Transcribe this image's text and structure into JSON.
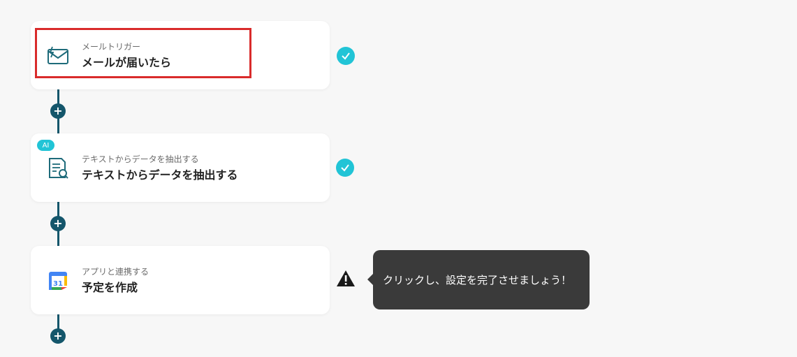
{
  "flow": {
    "steps": [
      {
        "subtitle": "メールトリガー",
        "title": "メールが届いたら",
        "icon": "mail-trigger-icon",
        "status": "check-icon"
      },
      {
        "subtitle": "テキストからデータを抽出する",
        "title": "テキストからデータを抽出する",
        "icon": "document-search-icon",
        "badge": "AI",
        "status": "check-icon"
      },
      {
        "subtitle": "アプリと連携する",
        "title": "予定を作成",
        "icon": "google-calendar-icon",
        "status": "warning-icon"
      }
    ],
    "calendar_day": "31",
    "add_step_symbol": "+",
    "tooltip": "クリックし、設定を完了させましょう！"
  },
  "colors": {
    "connector": "#14566b",
    "check": "#21c4d6",
    "highlight": "#d92b2b",
    "tooltip_bg": "#3a3a3a"
  }
}
